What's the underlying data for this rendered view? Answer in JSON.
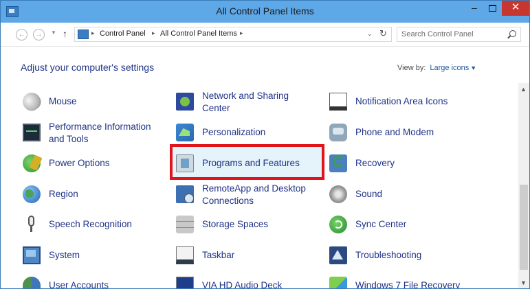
{
  "window": {
    "title": "All Control Panel Items"
  },
  "address": {
    "crumbs": [
      "Control Panel",
      "All Control Panel Items"
    ],
    "search_placeholder": "Search Control Panel"
  },
  "header": {
    "heading": "Adjust your computer's settings",
    "view_by_label": "View by:",
    "view_by_value": "Large icons"
  },
  "items": [
    {
      "label": "Mouse",
      "icon": "mouse-icon"
    },
    {
      "label": "Network and Sharing Center",
      "icon": "network-icon"
    },
    {
      "label": "Notification Area Icons",
      "icon": "notification-icon"
    },
    {
      "label": "Performance Information and Tools",
      "icon": "performance-icon"
    },
    {
      "label": "Personalization",
      "icon": "personalization-icon"
    },
    {
      "label": "Phone and Modem",
      "icon": "phone-icon"
    },
    {
      "label": "Power Options",
      "icon": "power-icon"
    },
    {
      "label": "Programs and Features",
      "icon": "programs-icon"
    },
    {
      "label": "Recovery",
      "icon": "recovery-icon"
    },
    {
      "label": "Region",
      "icon": "globe-icon"
    },
    {
      "label": "RemoteApp and Desktop Connections",
      "icon": "remote-desktop-icon"
    },
    {
      "label": "Sound",
      "icon": "speaker-icon"
    },
    {
      "label": "Speech Recognition",
      "icon": "microphone-icon"
    },
    {
      "label": "Storage Spaces",
      "icon": "storage-icon"
    },
    {
      "label": "Sync Center",
      "icon": "sync-icon"
    },
    {
      "label": "System",
      "icon": "computer-icon"
    },
    {
      "label": "Taskbar",
      "icon": "taskbar-icon"
    },
    {
      "label": "Troubleshooting",
      "icon": "troubleshooting-icon"
    },
    {
      "label": "User Accounts",
      "icon": "users-icon"
    },
    {
      "label": "VIA HD Audio Deck",
      "icon": "audio-deck-icon"
    },
    {
      "label": "Windows 7 File Recovery",
      "icon": "file-recovery-icon"
    }
  ],
  "highlighted_item": "Programs and Features",
  "colors": {
    "titlebar": "#5ea8e8",
    "link": "#1e3287",
    "highlight_border": "#e0141a",
    "close_button": "#c7372f"
  }
}
